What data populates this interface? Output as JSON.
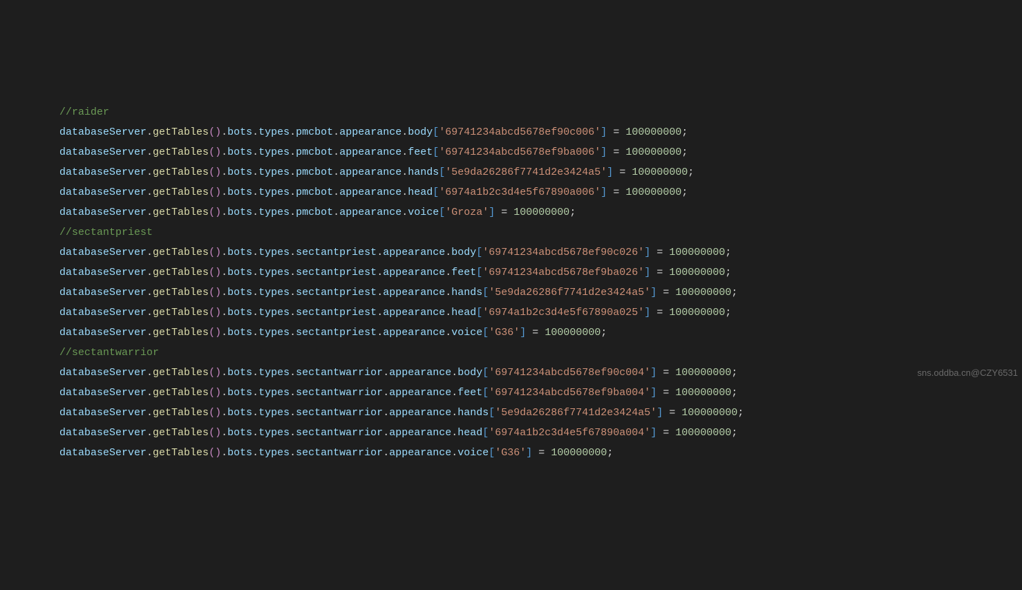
{
  "blocks": [
    {
      "comment": "//raider",
      "lines": [
        {
          "chain": "bots.types.pmcbot.appearance.body",
          "key": "'69741234abcd5678ef90c006'",
          "val": "100000000"
        },
        {
          "chain": "bots.types.pmcbot.appearance.feet",
          "key": "'69741234abcd5678ef9ba006'",
          "val": "100000000"
        },
        {
          "chain": "bots.types.pmcbot.appearance.hands",
          "key": "'5e9da26286f7741d2e3424a5'",
          "val": "100000000"
        },
        {
          "chain": "bots.types.pmcbot.appearance.head",
          "key": "'6974a1b2c3d4e5f67890a006'",
          "val": "100000000"
        },
        {
          "chain": "bots.types.pmcbot.appearance.voice",
          "key": "'Groza'",
          "val": "100000000"
        }
      ]
    },
    {
      "comment": "//sectantpriest",
      "lines": [
        {
          "chain": "bots.types.sectantpriest.appearance.body",
          "key": "'69741234abcd5678ef90c026'",
          "val": "100000000"
        },
        {
          "chain": "bots.types.sectantpriest.appearance.feet",
          "key": "'69741234abcd5678ef9ba026'",
          "val": "100000000"
        },
        {
          "chain": "bots.types.sectantpriest.appearance.hands",
          "key": "'5e9da26286f7741d2e3424a5'",
          "val": "100000000"
        },
        {
          "chain": "bots.types.sectantpriest.appearance.head",
          "key": "'6974a1b2c3d4e5f67890a025'",
          "val": "100000000"
        },
        {
          "chain": "bots.types.sectantpriest.appearance.voice",
          "key": "'G36'",
          "val": "100000000"
        }
      ]
    },
    {
      "comment": "//sectantwarrior",
      "lines": [
        {
          "chain": "bots.types.sectantwarrior.appearance.body",
          "key": "'69741234abcd5678ef90c004'",
          "val": "100000000"
        },
        {
          "chain": "bots.types.sectantwarrior.appearance.feet",
          "key": "'69741234abcd5678ef9ba004'",
          "val": "100000000"
        },
        {
          "chain": "bots.types.sectantwarrior.appearance.hands",
          "key": "'5e9da26286f7741d2e3424a5'",
          "val": "100000000"
        },
        {
          "chain": "bots.types.sectantwarrior.appearance.head",
          "key": "'6974a1b2c3d4e5f67890a004'",
          "val": "100000000"
        },
        {
          "chain": "bots.types.sectantwarrior.appearance.voice",
          "key": "'G36'",
          "val": "100000000"
        }
      ]
    }
  ],
  "obj": "databaseServer",
  "method": "getTables",
  "watermark": "sns.oddba.cn@CZY6531"
}
